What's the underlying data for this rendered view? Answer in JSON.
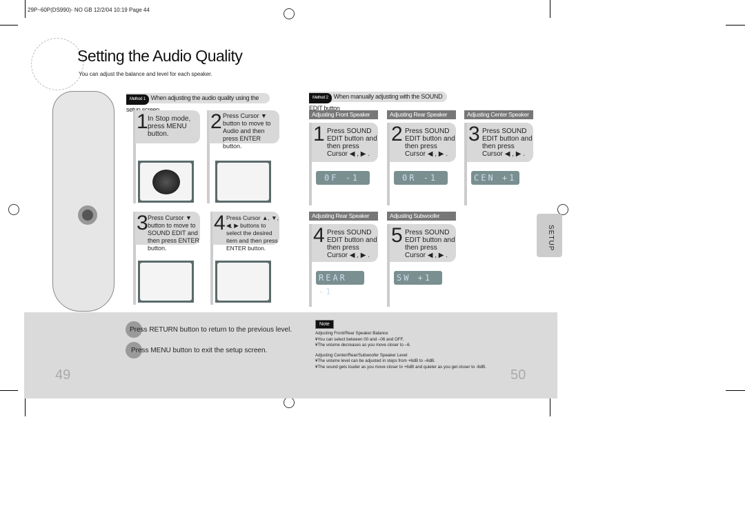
{
  "header": "29P~60P(DS990)- NO GB  12/2/04 10:19  Page 44",
  "title": "Setting the Audio Quality",
  "subtitle": "You can adjust the balance and level for each speaker.",
  "method1": {
    "badge": "Method 1",
    "label": "When adjusting the audio quality using the setup screen",
    "steps": [
      {
        "num": "1",
        "text": "In Stop mode, press MENU button."
      },
      {
        "num": "2",
        "text": "Press Cursor ▼ button to move to Audio and then press ENTER button."
      },
      {
        "num": "3",
        "text": "Press Cursor ▼ button to move to SOUND EDIT and then press ENTER button."
      },
      {
        "num": "4",
        "text": "Press Cursor ▲, ▼, ◀, ▶ buttons to select the desired item and then press ENTER button."
      }
    ]
  },
  "method2": {
    "badge": "Method 2",
    "label": "When manually adjusting with the SOUND EDIT button",
    "sections": [
      {
        "heading": "Adjusting Front Speaker Balance",
        "num": "1",
        "text": "Press SOUND EDIT button and then press Cursor ◀ , ▶ .",
        "display": "0F -1"
      },
      {
        "heading": "Adjusting Rear Speaker Balance",
        "num": "2",
        "text": "Press SOUND EDIT button and then press Cursor ◀ , ▶ .",
        "display": "0R -1"
      },
      {
        "heading": "Adjusting Center Speaker Level",
        "num": "3",
        "text": "Press SOUND EDIT button and then press Cursor ◀ , ▶ .",
        "display": "CEN +1"
      },
      {
        "heading": "Adjusting Rear Speaker Level",
        "num": "4",
        "text": "Press SOUND EDIT button and then press Cursor ◀ , ▶ .",
        "display": "REAR -1"
      },
      {
        "heading": "Adjusting Subwoofer Speaker Level",
        "num": "5",
        "text": "Press SOUND EDIT button and then press Cursor ◀ , ▶ .",
        "display": "SW +1"
      }
    ]
  },
  "bottom": {
    "return": "Press RETURN button to return to the previous level.",
    "menu": "Press MENU button to exit the setup screen."
  },
  "note": {
    "label": "Note",
    "h1": "Adjusting Front/Rear Speaker Balance",
    "l1": "¥You can select between 00 and –06 and OFF.",
    "l2": "¥The volume decreases as you move closer to –6.",
    "h2": "Adjusting Center/Rear/Subwoofer Speaker Level",
    "l3": "¥The volume level can be adjusted in steps from +6dB to –6dB.",
    "l4": "¥The sound gets louder as you move closer to +6dB and quieter as you get closer to -6dB."
  },
  "side_tab": "SETUP",
  "pages": {
    "left": "49",
    "right": "50"
  }
}
